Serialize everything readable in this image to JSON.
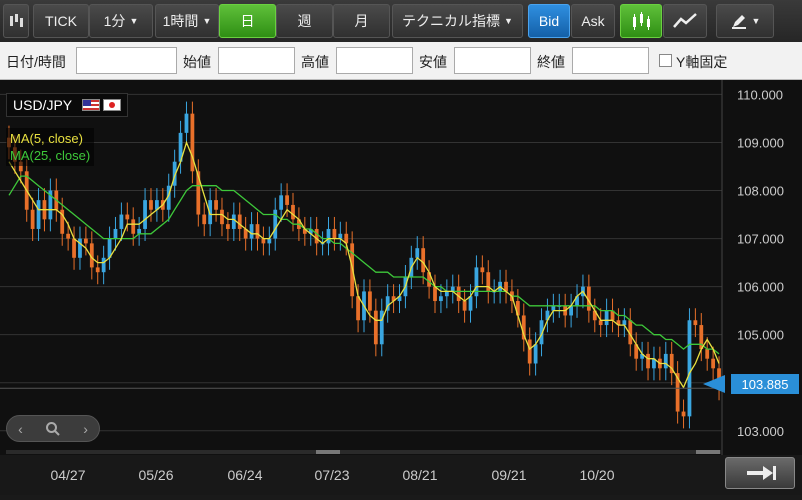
{
  "toolbar": {
    "tick": "TICK",
    "interval1": "1分",
    "interval2": "1時間",
    "day": "日",
    "week": "週",
    "month": "月",
    "technical": "テクニカル指標",
    "bid": "Bid",
    "ask": "Ask"
  },
  "fields": {
    "datetime": "日付/時間",
    "open": "始値",
    "high": "高値",
    "low": "安値",
    "close": "終値",
    "yaxis_fixed": "Y軸固定"
  },
  "symbol": "USD/JPY",
  "legend": [
    "MA(5, close)",
    "MA(25, close)"
  ],
  "current_price": "103.885",
  "colors": {
    "up": "#3aa6e0",
    "down": "#e8702a",
    "ma5": "#e8e040",
    "ma25": "#3ec83a",
    "price_tag": "#2a8fd8"
  },
  "chart_data": {
    "type": "candlestick",
    "y_ticks": [
      "110.000",
      "109.000",
      "108.000",
      "107.000",
      "106.000",
      "105.000",
      "104.000",
      "103.000"
    ],
    "x_labels": [
      "04/27",
      "05/26",
      "06/24",
      "07/23",
      "08/21",
      "09/21",
      "10/20"
    ],
    "ylim": [
      102.6,
      110.3
    ],
    "close": [
      108.9,
      108.6,
      108.4,
      107.6,
      107.2,
      107.8,
      107.4,
      108.0,
      107.6,
      107.1,
      107.0,
      106.6,
      107.0,
      106.9,
      106.4,
      106.3,
      106.6,
      107.0,
      107.2,
      107.5,
      107.4,
      107.1,
      107.2,
      107.8,
      107.6,
      107.8,
      107.6,
      108.1,
      108.6,
      109.2,
      109.6,
      108.4,
      107.5,
      107.3,
      107.8,
      107.6,
      107.3,
      107.2,
      107.5,
      107.2,
      107.0,
      107.3,
      107.0,
      106.9,
      107.0,
      107.6,
      107.9,
      107.7,
      107.4,
      107.2,
      107.1,
      107.2,
      106.9,
      106.9,
      107.2,
      107.0,
      107.1,
      106.9,
      105.8,
      105.3,
      105.9,
      105.5,
      104.8,
      105.5,
      105.8,
      105.7,
      105.8,
      106.2,
      106.6,
      106.8,
      106.3,
      106.0,
      105.7,
      105.8,
      105.9,
      106.0,
      105.7,
      105.5,
      105.8,
      106.4,
      106.3,
      105.9,
      105.9,
      106.1,
      105.9,
      105.7,
      105.4,
      104.9,
      104.4,
      104.8,
      105.3,
      105.5,
      105.6,
      105.6,
      105.4,
      105.6,
      105.8,
      106.0,
      105.5,
      105.3,
      105.2,
      105.5,
      105.3,
      105.2,
      105.3,
      104.8,
      104.5,
      104.6,
      104.3,
      104.5,
      104.3,
      104.6,
      104.2,
      103.4,
      103.3,
      105.3,
      105.2,
      104.7,
      104.5,
      104.3,
      103.885
    ],
    "ma5": [
      108.6,
      108.4,
      108.2,
      108.0,
      107.8,
      107.6,
      107.6,
      107.6,
      107.6,
      107.5,
      107.3,
      107.0,
      106.9,
      106.8,
      106.6,
      106.5,
      106.5,
      106.6,
      106.8,
      107.0,
      107.3,
      107.3,
      107.3,
      107.4,
      107.5,
      107.6,
      107.7,
      107.9,
      108.3,
      108.6,
      109.0,
      108.7,
      108.3,
      107.9,
      107.5,
      107.5,
      107.5,
      107.4,
      107.4,
      107.3,
      107.2,
      107.1,
      107.1,
      107.0,
      107.0,
      107.2,
      107.4,
      107.6,
      107.5,
      107.4,
      107.2,
      107.1,
      107.0,
      106.9,
      107.0,
      107.0,
      107.0,
      106.9,
      106.4,
      105.8,
      105.6,
      105.4,
      105.3,
      105.3,
      105.6,
      105.7,
      105.8,
      106.0,
      106.4,
      106.6,
      106.5,
      106.3,
      106.0,
      105.9,
      105.9,
      105.9,
      105.8,
      105.7,
      105.8,
      106.0,
      106.0,
      106.0,
      105.9,
      106.0,
      105.9,
      105.8,
      105.4,
      105.0,
      104.7,
      104.8,
      105.0,
      105.3,
      105.5,
      105.5,
      105.5,
      105.6,
      105.8,
      105.9,
      105.7,
      105.5,
      105.3,
      105.3,
      105.3,
      105.2,
      105.2,
      105.0,
      104.8,
      104.6,
      104.5,
      104.5,
      104.4,
      104.4,
      104.3,
      104.1,
      103.9,
      104.2,
      104.4,
      104.7,
      104.9,
      104.7,
      104.4
    ],
    "ma25": [
      107.9,
      108.1,
      108.3,
      108.3,
      108.2,
      108.1,
      108.0,
      107.9,
      107.8,
      107.7,
      107.6,
      107.5,
      107.4,
      107.3,
      107.2,
      107.1,
      107.0,
      107.0,
      107.0,
      107.0,
      107.0,
      107.0,
      107.1,
      107.1,
      107.1,
      107.2,
      107.3,
      107.4,
      107.6,
      107.8,
      108.0,
      108.1,
      108.1,
      108.1,
      108.1,
      108.1,
      108.0,
      108.0,
      108.0,
      107.9,
      107.8,
      107.7,
      107.6,
      107.5,
      107.5,
      107.5,
      107.4,
      107.4,
      107.3,
      107.3,
      107.2,
      107.2,
      107.1,
      107.0,
      107.0,
      106.9,
      106.9,
      106.8,
      106.7,
      106.6,
      106.5,
      106.4,
      106.3,
      106.3,
      106.3,
      106.2,
      106.2,
      106.2,
      106.2,
      106.2,
      106.2,
      106.1,
      106.0,
      106.0,
      105.9,
      105.9,
      105.9,
      105.9,
      105.9,
      105.9,
      105.9,
      105.9,
      105.9,
      105.9,
      105.9,
      105.8,
      105.8,
      105.7,
      105.6,
      105.6,
      105.6,
      105.6,
      105.6,
      105.6,
      105.6,
      105.6,
      105.6,
      105.6,
      105.6,
      105.6,
      105.5,
      105.5,
      105.5,
      105.4,
      105.4,
      105.3,
      105.2,
      105.2,
      105.1,
      105.0,
      105.0,
      104.9,
      104.9,
      104.8,
      104.7,
      104.8,
      104.8,
      104.8,
      104.7,
      104.7,
      104.6
    ]
  }
}
